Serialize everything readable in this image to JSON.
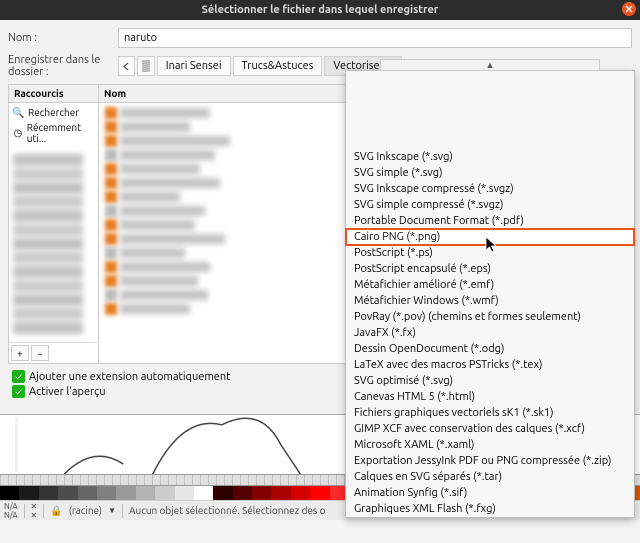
{
  "title": "Sélectionner le fichier dans lequel enregistrer",
  "name_label": "Nom :",
  "name_value": "naruto",
  "folder_label": "Enregistrer dans le dossier :",
  "breadcrumbs": [
    "Inari Sensei",
    "Trucs&Astuces",
    "Vectoriser u"
  ],
  "shortcuts_header": "Raccourcis",
  "name_header": "Nom",
  "shortcuts": {
    "search": "Rechercher",
    "recent": "Récemment uti..."
  },
  "add_ext": "Ajouter une extension automatiquement",
  "preview": "Activer l'aperçu",
  "formats": [
    "SVG Inkscape (*.svg)",
    "SVG simple (*.svg)",
    "SVG Inkscape compressé (*.svgz)",
    "SVG simple compressé (*.svgz)",
    "Portable Document Format (*.pdf)",
    "Cairo PNG (*.png)",
    "PostScript (*.ps)",
    "PostScript encapsulé (*.eps)",
    "Métafichier amélioré (*.emf)",
    "Métafichier Windows (*.wmf)",
    "PovRay (*.pov) (chemins et formes seulement)",
    "JavaFX (*.fx)",
    "Dessin OpenDocument (*.odg)",
    "LaTeX avec des macros PSTricks (*.tex)",
    "SVG optimisé (*.svg)",
    "Canevas HTML 5 (*.html)",
    "Fichiers graphiques vectoriels sK1 (*.sk1)",
    "GIMP XCF avec conservation des calques (*.xcf)",
    "Microsoft XAML (*.xaml)",
    "Exportation JessyInk PDF ou PNG compressée (*.zip)",
    "Calques en SVG séparés (*.tar)",
    "Animation Synfig (*.sif)",
    "Graphiques XML Flash (*.fxg)"
  ],
  "highlight_index": 5,
  "palette_colors": [
    "#000000",
    "#1a1a1a",
    "#333333",
    "#4d4d4d",
    "#666666",
    "#808080",
    "#999999",
    "#b3b3b3",
    "#cccccc",
    "#e6e6e6",
    "#ffffff",
    "#2f0000",
    "#550000",
    "#800000",
    "#aa0000",
    "#d40000",
    "#ff0000",
    "#ff2a2a",
    "#ff5555",
    "#ff8080",
    "#ffaaaa",
    "#ffd5d5",
    "#280b0b",
    "#501616",
    "#782121",
    "#a02c2c",
    "#c83737",
    "#d35f5f",
    "#de8787",
    "#552200",
    "#803300",
    "#aa4400",
    "#d45500"
  ],
  "status": {
    "na": "N/A",
    "root": "(racine)",
    "msg": "Aucun objet sélectionné. Sélectionnez des o"
  }
}
